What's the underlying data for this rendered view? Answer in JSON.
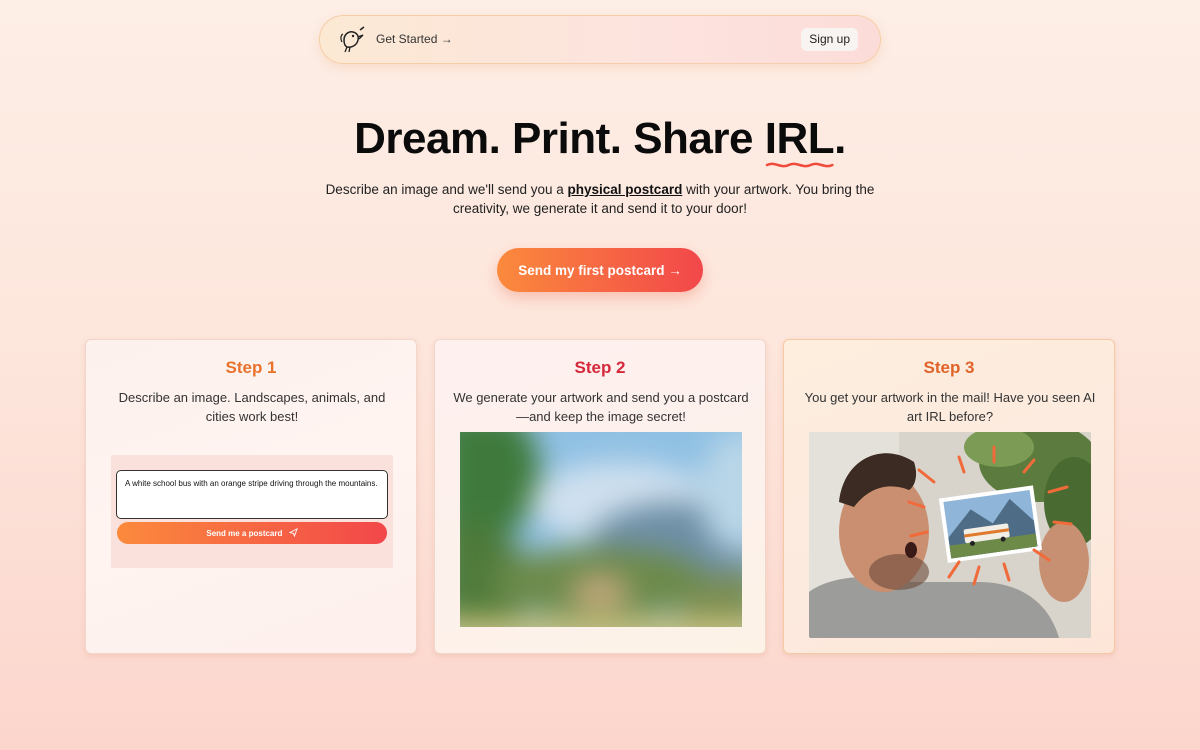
{
  "nav": {
    "logo_icon": "bird-brush-logo",
    "get_started": "Get Started →",
    "signup": "Sign up"
  },
  "hero": {
    "title_main": "Dream. Print. Share ",
    "title_irl": "IRL",
    "title_end": ".",
    "subtitle_before": "Describe an image and we'll send you a ",
    "subtitle_emphasis": "physical postcard",
    "subtitle_after": " with your artwork. You bring the creativity, we generate it and send it to your door!",
    "cta": "Send my first postcard →"
  },
  "steps": [
    {
      "title": "Step 1",
      "text": "Describe an image. Landscapes, animals, and cities work best!",
      "prompt_value": "A white school bus with an orange stripe driving through the mountains.",
      "send_label": "Send me a postcard",
      "send_icon": "paper-plane-icon"
    },
    {
      "title": "Step 2",
      "text": "We generate your artwork and send you a postcard—and keep the image secret!"
    },
    {
      "title": "Step 3",
      "text": "You get your artwork in the mail! Have you seen AI art IRL before?"
    }
  ],
  "colors": {
    "accent_start": "#fb8a3c",
    "accent_end": "#f2474a",
    "step1": "#e8722c",
    "step2": "#d6283b",
    "step3": "#e0632a"
  }
}
